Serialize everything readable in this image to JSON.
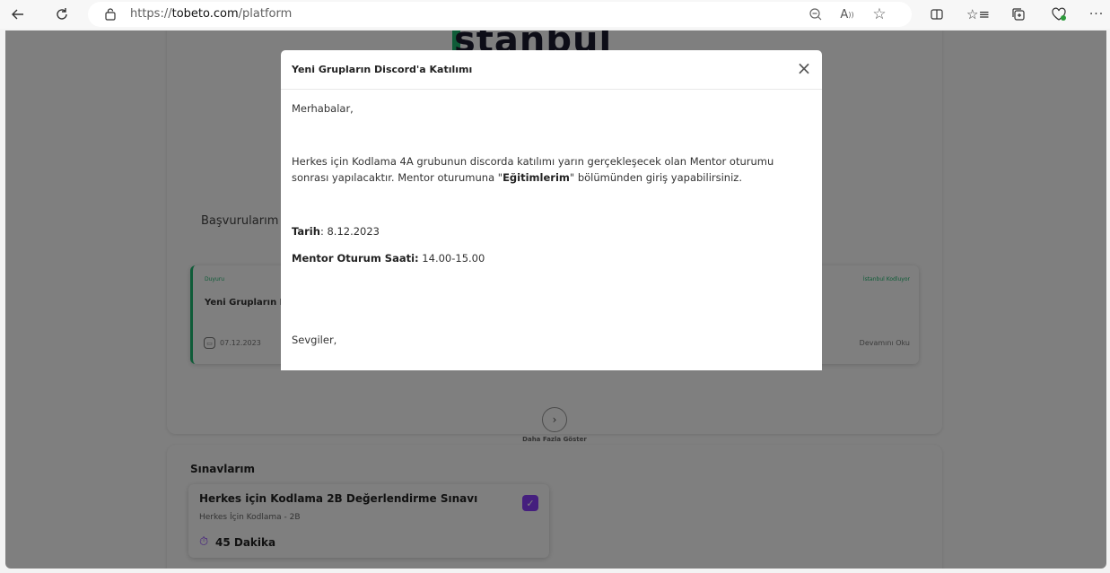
{
  "browser": {
    "url_prefix": "https://",
    "url_host": "tobeto.com",
    "url_path": "/platform",
    "icons": [
      "back-icon",
      "refresh-icon",
      "site-info-icon",
      "zoom-out-icon",
      "read-aloud-icon",
      "favorite-icon",
      "split-screen-icon",
      "favorites-list-icon",
      "collections-icon",
      "browser-essentials-icon",
      "more-icon"
    ]
  },
  "page": {
    "logo_text": "stanbul",
    "applications_title": "Başvurularım",
    "announcement": {
      "type": "Duyuru",
      "org": "İstanbul Kodluyor",
      "title": "Yeni Grupların D",
      "date": "07.12.2023",
      "read_more": "Devamını Oku"
    },
    "show_more_label": "Daha Fazla Göster",
    "exams_title": "Sınavlarım",
    "exam": {
      "title": "Herkes için Kodlama 2B Değerlendirme Sınavı",
      "subtitle": "Herkes İçin Kodlama - 2B",
      "duration": "45 Dakika"
    }
  },
  "modal": {
    "title": "Yeni Grupların Discord'a Katılımı",
    "greeting": "Merhabalar,",
    "body_line1": "Herkes için Kodlama 4A grubunun discorda katılımı yarın gerçekleşecek olan Mentor oturumu",
    "body_line2_pre": "sonrası yapılacaktır. Mentor oturumuna \"",
    "body_line2_bold": "Eğitimlerim",
    "body_line2_post": "\" bölümünden giriş yapabilirsiniz.",
    "date_label": "Tarih",
    "date_value": ": 8.12.2023",
    "session_label": "Mentor Oturum Saati:",
    "session_value": " 14.00-15.00",
    "closing": "Sevgiler,"
  },
  "colors": {
    "accent_green": "#1fb870",
    "accent_purple": "#8a3ffc"
  }
}
